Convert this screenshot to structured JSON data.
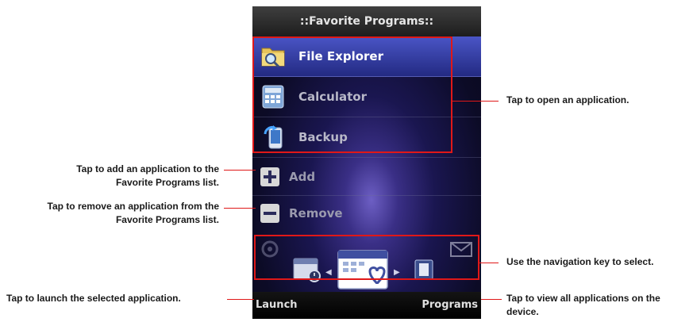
{
  "screen": {
    "title": "::Favorite Programs::",
    "programs": [
      {
        "label": "File Explorer",
        "icon": "folder-search-icon",
        "selected": true
      },
      {
        "label": "Calculator",
        "icon": "calculator-icon",
        "selected": false
      },
      {
        "label": "Backup",
        "icon": "backup-icon",
        "selected": false
      }
    ],
    "actions": {
      "add": {
        "label": "Add",
        "icon": "plus-icon"
      },
      "remove": {
        "label": "Remove",
        "icon": "minus-icon"
      }
    },
    "softkeys": {
      "left": "Launch",
      "right": "Programs"
    }
  },
  "callouts": {
    "open_app": "Tap to open an application.",
    "add_app_line1": "Tap to add an application to the",
    "add_app_line2": "Favorite Programs list.",
    "remove_app_line1": "Tap to remove an application from the",
    "remove_app_line2": "Favorite Programs list.",
    "nav_key": "Use the navigation key to select.",
    "launch": "Tap to launch the selected application.",
    "view_all_line1": "Tap to view all applications on the",
    "view_all_line2": "device."
  },
  "colors": {
    "highlight": "#e01818",
    "selected_row": "#3a45b8",
    "callout_text": "#1a1a1a"
  }
}
